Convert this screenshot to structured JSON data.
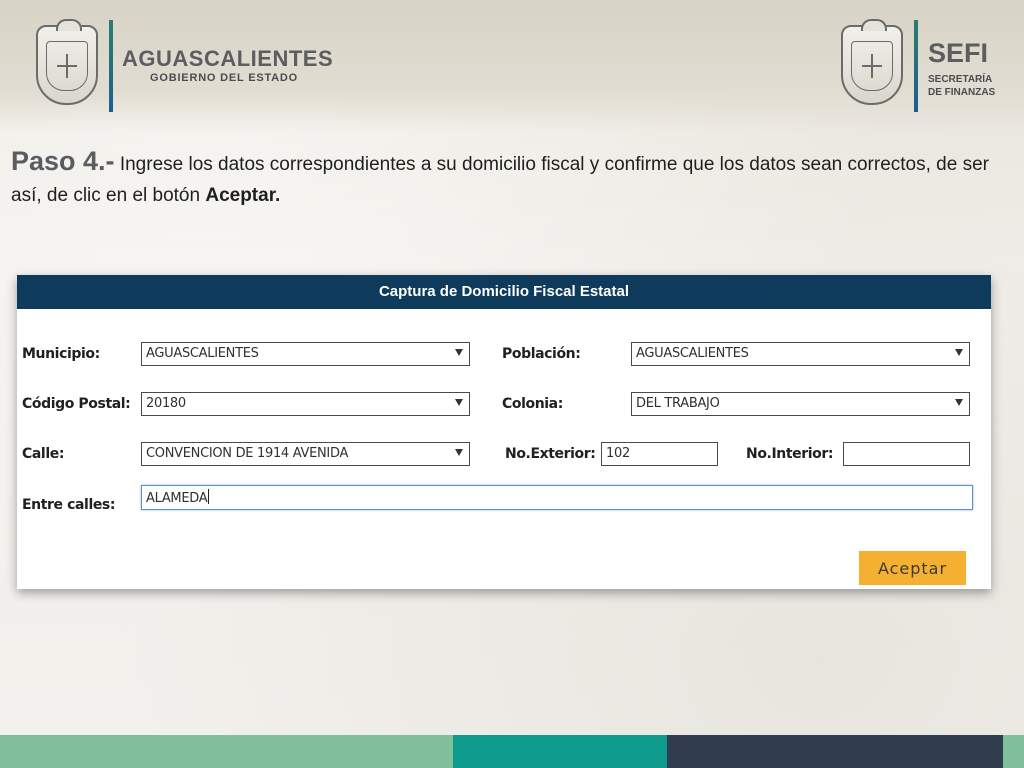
{
  "header": {
    "left_brand": {
      "title": "AGUASCALIENTES",
      "subtitle": "GOBIERNO DEL ESTADO"
    },
    "right_brand": {
      "title": "SEFI",
      "subtitle_line1": "SECRETARÍA",
      "subtitle_line2": "DE FINANZAS"
    }
  },
  "instruction": {
    "step": "Paso 4.-",
    "text": " Ingrese los datos correspondientes a su domicilio fiscal y confirme que los datos sean correctos, de ser así, de clic en el botón ",
    "bold_word": "Aceptar."
  },
  "form": {
    "title": "Captura de Domicilio Fiscal Estatal",
    "municipio": {
      "label": "Municipio:",
      "value": "AGUASCALIENTES"
    },
    "poblacion": {
      "label": "Población:",
      "value": "AGUASCALIENTES"
    },
    "codigo_postal": {
      "label": "Código Postal:",
      "value": "20180"
    },
    "colonia": {
      "label": "Colonia:",
      "value": "DEL TRABAJO"
    },
    "calle": {
      "label": "Calle:",
      "value": "CONVENCION DE 1914 AVENIDA"
    },
    "no_exterior": {
      "label": "No.Exterior:",
      "value": "102"
    },
    "no_interior": {
      "label": "No.Interior:",
      "value": ""
    },
    "entre_calles": {
      "label": "Entre calles:",
      "value": "ALAMEDA"
    },
    "accept_label": "Aceptar"
  },
  "colors": {
    "header_bar": "#0e3a5b",
    "accept_button": "#f6b031",
    "footer": [
      "#7fbf9a",
      "#0f9a8e",
      "#2f3d4f",
      "#7fbf9a"
    ]
  }
}
